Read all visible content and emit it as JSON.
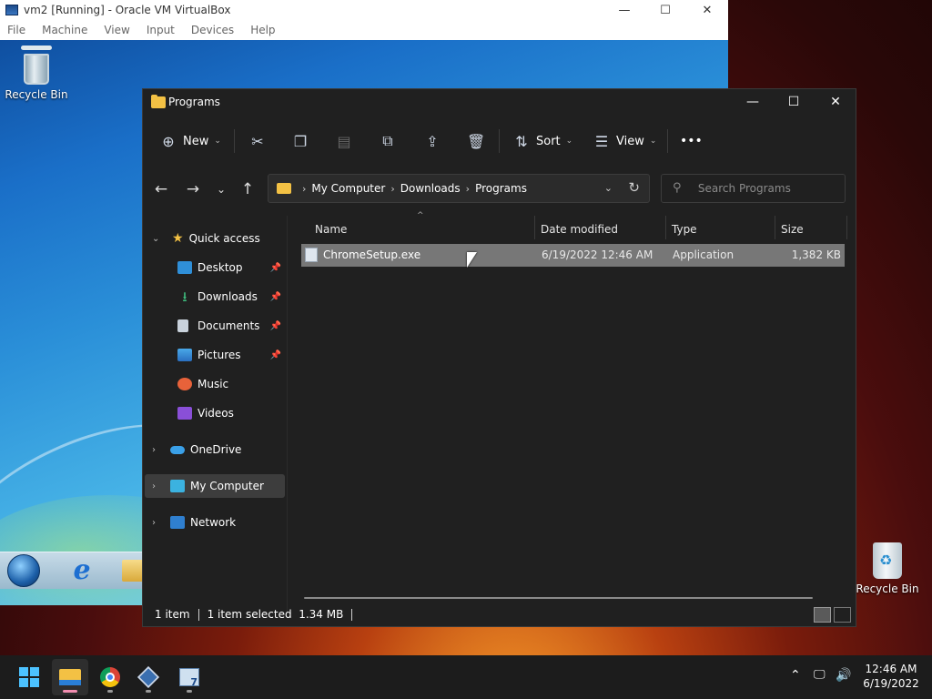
{
  "vbox": {
    "title": "vm2 [Running] - Oracle VM VirtualBox",
    "menu": [
      "File",
      "Machine",
      "View",
      "Input",
      "Devices",
      "Help"
    ],
    "desktop_icon_label": "Recycle Bin"
  },
  "explorer": {
    "title": "Programs",
    "toolbar": {
      "new_label": "New",
      "sort_label": "Sort",
      "view_label": "View",
      "more_label": "•••"
    },
    "breadcrumb": [
      "My Computer",
      "Downloads",
      "Programs"
    ],
    "search_placeholder": "Search Programs",
    "sidebar": {
      "quick_access": "Quick access",
      "pinned": [
        {
          "label": "Desktop",
          "icon": "desktop-icon",
          "pinned": true
        },
        {
          "label": "Downloads",
          "icon": "downloads-icon",
          "pinned": true
        },
        {
          "label": "Documents",
          "icon": "documents-icon",
          "pinned": true
        },
        {
          "label": "Pictures",
          "icon": "pictures-icon",
          "pinned": true
        },
        {
          "label": "Music",
          "icon": "music-icon",
          "pinned": false
        },
        {
          "label": "Videos",
          "icon": "videos-icon",
          "pinned": false
        }
      ],
      "onedrive": "OneDrive",
      "my_computer": "My Computer",
      "network": "Network"
    },
    "columns": [
      "Name",
      "Date modified",
      "Type",
      "Size"
    ],
    "files": [
      {
        "name": "ChromeSetup.exe",
        "date": "6/19/2022 12:46 AM",
        "type": "Application",
        "size": "1,382 KB"
      }
    ],
    "status": {
      "count": "1 item",
      "selected": "1 item selected  1.34 MB"
    }
  },
  "desktop": {
    "recycle_label": "Recycle Bin"
  },
  "taskbar": {
    "apps": [
      "start",
      "file-explorer",
      "chrome",
      "virtualbox",
      "vm"
    ],
    "time": "12:46 AM",
    "date": "6/19/2022"
  },
  "colors": {
    "explorer_bg": "#202020",
    "selection": "#777777",
    "accent": "#4cc2ff"
  }
}
